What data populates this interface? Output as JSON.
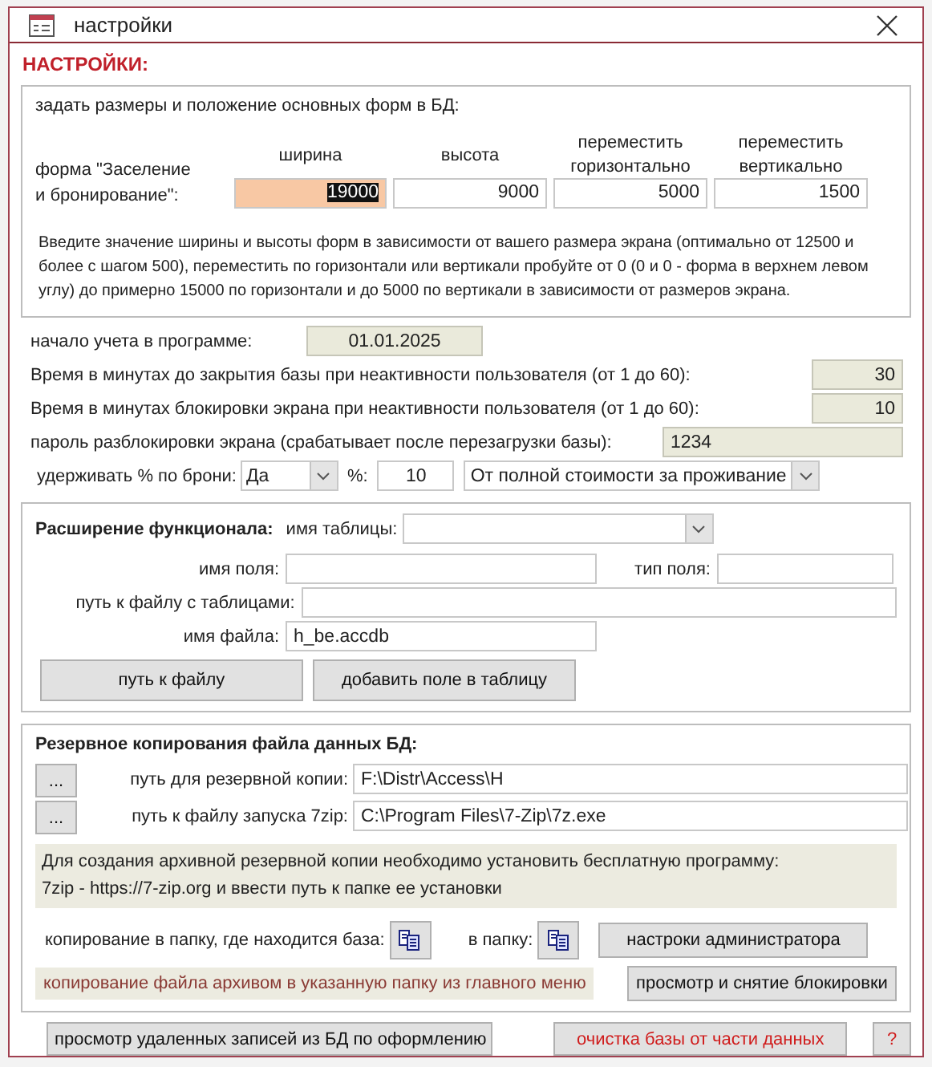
{
  "window": {
    "title": "настройки"
  },
  "heading": "НАСТРОЙКИ:",
  "form_size": {
    "title": "задать размеры и положение основных форм в БД:",
    "columns": [
      {
        "line1": "ширина"
      },
      {
        "line1": "высота"
      },
      {
        "line1": "переместить",
        "line2": "горизонтально"
      },
      {
        "line1": "переместить",
        "line2": "вертикально"
      }
    ],
    "row_label": {
      "line1": "форма \"Заселение",
      "line2": "и бронирование\":"
    },
    "values": [
      {
        "value": "19000",
        "selected": true
      },
      {
        "value": "9000",
        "selected": false
      },
      {
        "value": "5000",
        "selected": false
      },
      {
        "value": "1500",
        "selected": false
      }
    ],
    "note": "Введите значение ширины и высоты форм в зависимости от вашего размера экрана (оптимально от 12500 и более с шагом 500), переместить по горизонтали или вертикали пробуйте от 0 (0 и 0 - форма в верхнем левом углу) до примерно 15000 по горизонтали и до 5000 по вертикали в зависимости от размеров экрана."
  },
  "start": {
    "label": "начало учета в программе:",
    "value": "01.01.2025"
  },
  "timeouts": [
    {
      "label": "Время в минутах до закрытия базы при неактивности пользователя (от 1 до 60):",
      "value": "30"
    },
    {
      "label": "Время в минутах блокировки экрана при неактивности пользователя (от 1 до 60):",
      "value": "10"
    }
  ],
  "password": {
    "label": "пароль разблокировки экрана (срабатывает после перезагрузки базы):",
    "value": "1234"
  },
  "hold": {
    "label": "удерживать % по брони:",
    "value": "Да",
    "percent_label": "%:",
    "percent_value": "10",
    "basis": "От полной стоимости за проживание"
  },
  "extension": {
    "title": "Расширение функционала:",
    "table_label": "имя таблицы:",
    "field_label": "имя поля:",
    "type_label": "тип поля:",
    "path_label": "путь к файлу с таблицами:",
    "file_label": "имя файла:",
    "file_value": "h_be.accdb",
    "buttons": [
      "путь к файлу",
      "добавить поле в таблицу"
    ]
  },
  "backup": {
    "title": "Резервное копирования файла данных БД:",
    "paths": [
      {
        "browse": "...",
        "label": "путь для резервной копии:",
        "value": "F:\\Distr\\Access\\H"
      },
      {
        "browse": "...",
        "label": "путь к файлу запуска 7zip:",
        "value": "C:\\Program Files\\7-Zip\\7z.exe"
      }
    ],
    "note_lines": [
      "Для создания архивной резервной копии необходимо установить бесплатную программу:",
      "7zip - https://7-zip.org и ввести путь к папке ее установки"
    ],
    "copy_here_label": "копирование в папку, где находится база:",
    "copy_to_label": "в папку:",
    "admin_button": "настроки администратора",
    "archive_note": "копирование файла архивом в указанную папку из главного меню",
    "unlock_button": "просмотр и снятие блокировки"
  },
  "footer_buttons": [
    {
      "label": "просмотр удаленных записей из БД по оформлению",
      "kind": "normal"
    },
    {
      "label": "очистка базы от части данных",
      "kind": "danger"
    },
    {
      "label": "?",
      "kind": "danger"
    }
  ]
}
